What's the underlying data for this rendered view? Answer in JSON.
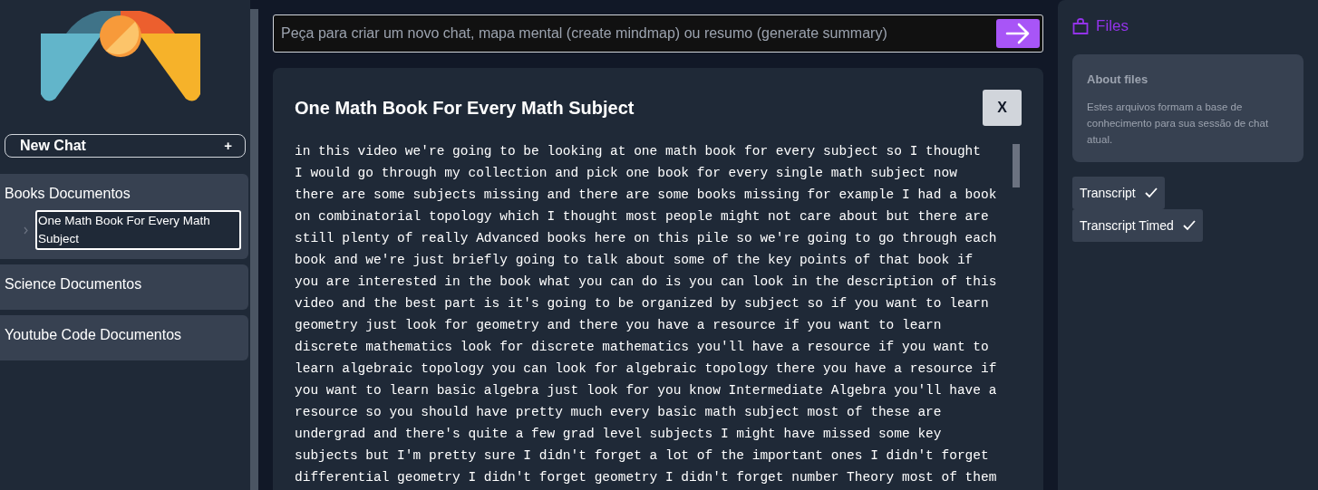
{
  "sidebar": {
    "new_chat": {
      "label": "New Chat",
      "icon": "+"
    },
    "folders": [
      {
        "label": "Books Documentos",
        "expanded": true,
        "children": [
          {
            "label": "One Math Book For Every Math Subject",
            "selected": true
          }
        ]
      },
      {
        "label": "Science Documentos"
      },
      {
        "label": "Youtube Code Documentos"
      }
    ]
  },
  "prompt": {
    "placeholder": "Peça para criar um novo chat, mapa mental (create mindmap) ou resumo (generate summary)"
  },
  "document": {
    "title": "One Math Book For Every Math Subject",
    "close": "X",
    "transcript_lines": [
      "in this video we're going to be looking at one math book for every subject so I thought",
      "I would go through my collection and pick one book for every single math subject now",
      "there are some subjects missing and there are some books missing for example I had a book",
      "on combinatorial topology which I thought most people might not care about but there are",
      "still plenty of really Advanced books here on this pile so we're going to go through each",
      "book and we're just briefly going to talk about some of the key points of that book if",
      "you are interested in the book what you can do is you can look in the description of this",
      "video and the best part is it's going to be organized by subject so if you want to learn",
      "geometry just look for geometry and there you have a resource if you want to learn",
      "discrete mathematics look for discrete mathematics you'll have a resource if you want to",
      "learn algebraic topology you can look for algebraic topology there you have a resource if",
      "you want to learn basic algebra just look for you know Intermediate Algebra you'll have a",
      "resource so you should have pretty much every basic math subject most of these are",
      "undergrad and there's quite a few grad level subjects I might have missed some key",
      "subjects but I'm pretty sure I didn't forget a lot of the important ones I didn't forget",
      "differential geometry I didn't forget geometry I didn't forget number Theory most of them"
    ]
  },
  "files": {
    "title": "Files",
    "about": {
      "title": "About files",
      "text": "Estes arquivos formam a base de conhecimento para sua sessão de chat atual."
    },
    "items": [
      {
        "label": "Transcript",
        "checked": true
      },
      {
        "label": "Transcript Timed",
        "checked": true
      }
    ]
  }
}
